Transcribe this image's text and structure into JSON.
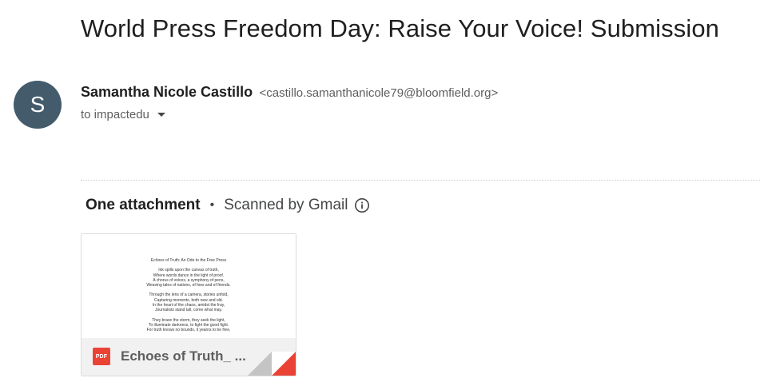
{
  "email": {
    "subject": "World Press Freedom Day: Raise Your Voice! Submission",
    "sender": {
      "initial": "S",
      "name": "Samantha Nicole Castillo",
      "email": "<castillo.samanthanicole79@bloomfield.org>",
      "avatar_color": "#435b6b"
    },
    "recipient_line": "to impactedu"
  },
  "attachments": {
    "count_label": "One attachment",
    "separator": "•",
    "scanned_label": "Scanned by Gmail",
    "info_icon": "info-icon",
    "file": {
      "name": "Echoes of Truth_ ...",
      "type_label": "PDF",
      "type_color": "#ea4335",
      "preview": {
        "title": "Echoes of Truth: An Ode to the Free Press",
        "stanza1": [
          "Ink spills upon the canvas of truth,",
          "Where words dance in the light of proof.",
          "A chorus of voices, a symphony of pens,",
          "Weaving tales of nations, of foes and of friends."
        ],
        "stanza2": [
          "Through the lens of a camera, stories unfold,",
          "Capturing moments, both new and old.",
          "In the heart of the chaos, amidst the fray,",
          "Journalists stand tall, come what may."
        ],
        "stanza3": [
          "They brave the storm, they seek the light,",
          "To illuminate darkness, to fight the good fight.",
          "For truth knows no bounds, it yearns to be free,"
        ]
      }
    }
  }
}
